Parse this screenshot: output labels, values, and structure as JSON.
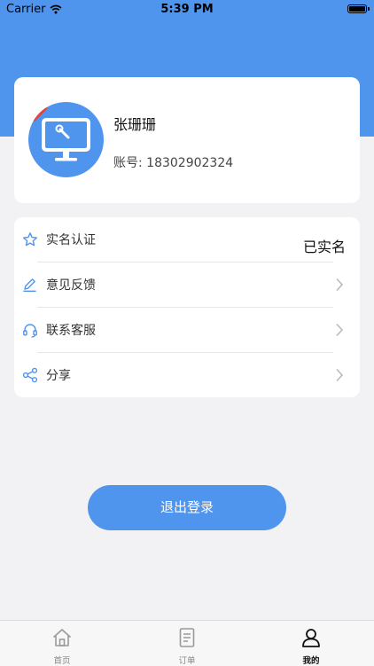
{
  "status_bar": {
    "carrier": "Carrier",
    "time": "5:39 PM"
  },
  "profile": {
    "name": "张珊珊",
    "account_label": "账号:",
    "account_number": "18302902324"
  },
  "menu": {
    "items": [
      {
        "label": "实名认证",
        "icon": "star-icon",
        "status": "已实名"
      },
      {
        "label": "意见反馈",
        "icon": "pencil-icon"
      },
      {
        "label": "联系客服",
        "icon": "headset-icon"
      },
      {
        "label": "分享",
        "icon": "share-icon"
      }
    ]
  },
  "logout_label": "退出登录",
  "tabs": [
    {
      "label": "首页",
      "icon": "home-icon",
      "active": false
    },
    {
      "label": "订单",
      "icon": "order-icon",
      "active": false
    },
    {
      "label": "我的",
      "icon": "user-icon",
      "active": true
    }
  ],
  "colors": {
    "primary": "#4f95ee",
    "background": "#f2f2f4",
    "card": "#ffffff"
  }
}
